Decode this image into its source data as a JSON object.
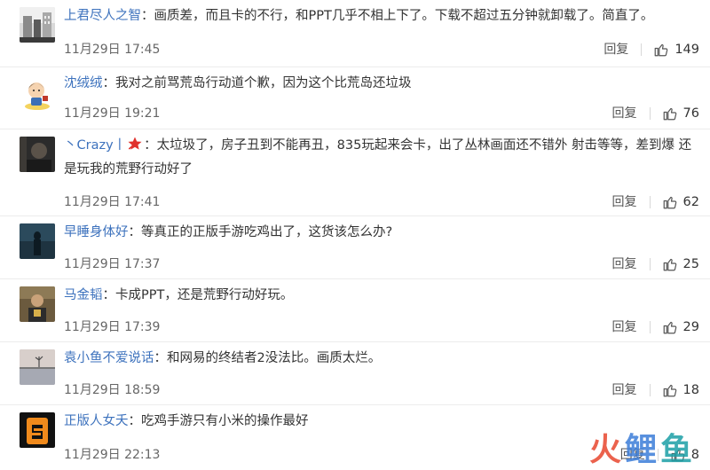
{
  "comments": [
    {
      "user": "上君尽人之智",
      "text": "画质差，而且卡的不行，和PPT几乎不相上下了。下载不超过五分钟就卸载了。简直了。",
      "time": "11月29日 17:45",
      "reply": "回复",
      "likes": "149",
      "avatar": "building-photo-avatar"
    },
    {
      "user": "沈绒绒",
      "text": "我对之前骂荒岛行动道个歉，因为这个比荒岛还垃圾",
      "time": "11月29日 19:21",
      "reply": "回复",
      "likes": "76",
      "avatar": "cartoon-avatar"
    },
    {
      "user": "丶Crazy丨",
      "text": "太垃圾了，房子丑到不能再丑，835玩起来会卡，出了丛林画面还不错外 射击等等，差到爆 还是玩我的荒野行动好了",
      "time": "11月29日 17:41",
      "reply": "回复",
      "likes": "62",
      "avatar": "dark-portrait-avatar",
      "badge": "red-star-icon"
    },
    {
      "user": "早睡身体好",
      "text": "等真正的正版手游吃鸡出了，这货该怎么办?",
      "time": "11月29日 17:37",
      "reply": "回复",
      "likes": "25",
      "avatar": "dark-figure-avatar"
    },
    {
      "user": "马金韬",
      "text": "卡成PPT，还是荒野行动好玩。",
      "time": "11月29日 17:39",
      "reply": "回复",
      "likes": "29",
      "avatar": "person-photo-avatar"
    },
    {
      "user": "袁小鱼不爱说话",
      "text": "和网易的终结者2没法比。画质太烂。",
      "time": "11月29日 18:59",
      "reply": "回复",
      "likes": "18",
      "avatar": "lake-landscape-avatar"
    },
    {
      "user": "正版人女夭",
      "text": "吃鸡手游只有小米的操作最好",
      "time": "11月29日 22:13",
      "reply": "回复",
      "likes": "8",
      "avatar": "orange-logo-avatar"
    }
  ],
  "watermark": {
    "chars": [
      "火",
      "鲤",
      "鱼"
    ],
    "colors": [
      "#e8472f",
      "#3c7dd9",
      "#1c9fa6"
    ]
  },
  "colors": {
    "username": "#3d72bd",
    "text": "#333333",
    "meta": "#666666",
    "divider": "#ececec"
  }
}
